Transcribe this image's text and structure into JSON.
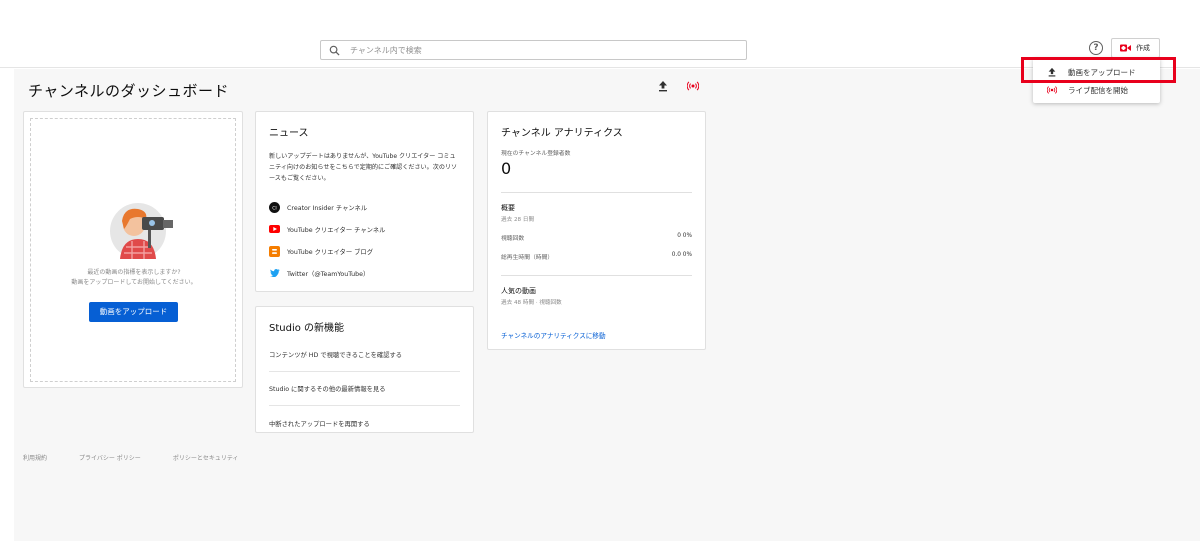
{
  "search": {
    "placeholder": "チャンネル内で検索"
  },
  "header": {
    "help_label": "?",
    "create_label": "作成"
  },
  "dashboard": {
    "title": "チャンネルのダッシュボード"
  },
  "upload_card": {
    "hint_line1": "最近の動画の指標を表示しますか?",
    "hint_line2": "動画をアップロードしてお開始してください。",
    "button_label": "動画をアップロード"
  },
  "news": {
    "title": "ニュース",
    "text": "新しいアップデートはありませんが、YouTube クリエイター コミュニティ向けのお知らせをこちらで定期的にご確認ください。次のリソースもご覧ください。",
    "links": [
      {
        "label": "Creator Insider チャンネル",
        "icon": "creator-insider-icon"
      },
      {
        "label": "YouTube クリエイター チャンネル",
        "icon": "youtube-icon"
      },
      {
        "label": "YouTube クリエイター ブログ",
        "icon": "blogger-icon"
      },
      {
        "label": "Twitter（@TeamYouTube）",
        "icon": "twitter-icon"
      }
    ]
  },
  "whats_new": {
    "title": "Studio の新機能",
    "items": [
      "コンテンツが HD で視聴できることを確認する",
      "Studio に関するその他の最新情報を見る",
      "中断されたアップロードを再開する"
    ]
  },
  "analytics": {
    "title": "チャンネル アナリティクス",
    "subs_label": "現在のチャンネル登録者数",
    "subs_value": "0",
    "summary_title": "概要",
    "summary_period": "過去 28 日間",
    "views_label": "視聴回数",
    "views_value": "0",
    "views_change": "0%",
    "watch_label": "総再生時間（時間）",
    "watch_value": "0.0",
    "watch_change": "0%",
    "popular_title": "人気の動画",
    "popular_period": "過去 48 時間 · 視聴回数",
    "link_label": "チャンネルのアナリティクスに移動"
  },
  "footer": {
    "links": [
      "利用規約",
      "プライバシー ポリシー",
      "ポリシーとセキュリティ"
    ]
  },
  "create_menu": {
    "items": [
      {
        "label": "動画をアップロード",
        "icon": "upload-icon"
      },
      {
        "label": "ライブ配信を開始",
        "icon": "live-icon"
      }
    ]
  },
  "colors": {
    "accent_blue": "#065fd4",
    "brand_red": "#e8001c",
    "highlight_red": "#e8001c"
  }
}
